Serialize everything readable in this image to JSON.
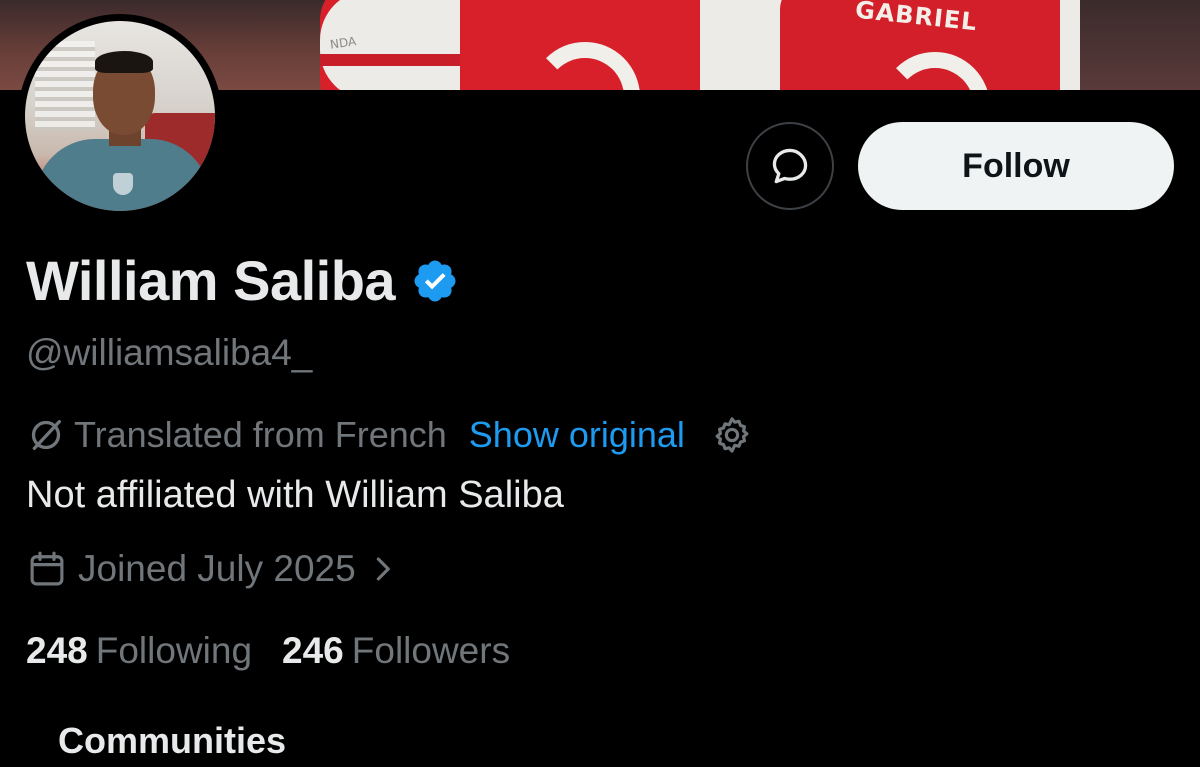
{
  "banner": {
    "jersey_name": "GABRIEL",
    "sponsor_text": "NDA"
  },
  "actions": {
    "message_icon": "chat-bubble-icon",
    "follow_label": "Follow"
  },
  "profile": {
    "display_name": "William Saliba",
    "verified_icon": "verified-badge-icon",
    "verified_color": "#1d9bf0",
    "handle": "@williamsaliba4_",
    "translation": {
      "label": "Translated from French",
      "link": "Show original",
      "icon": "translate-slash-icon",
      "settings_icon": "gear-icon"
    },
    "bio": "Not affiliated with William Saliba",
    "joined": {
      "text": "Joined July 2025",
      "icon": "calendar-icon",
      "chevron_icon": "chevron-right-icon"
    },
    "stats": {
      "following_count": "248",
      "following_label": "Following",
      "followers_count": "246",
      "followers_label": "Followers"
    }
  },
  "tabs": {
    "communities_label": "Communities"
  },
  "colors": {
    "background": "#000000",
    "text_primary": "#e7e9ea",
    "text_secondary": "#71767b",
    "link": "#1d9bf0",
    "follow_bg": "#eff3f4"
  }
}
